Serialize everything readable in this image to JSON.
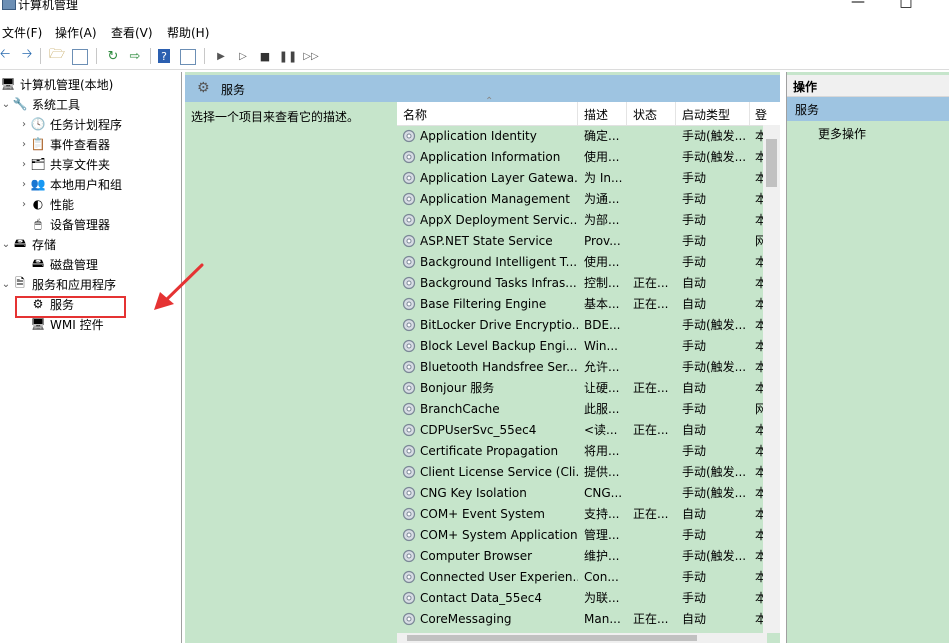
{
  "window": {
    "title": "计算机管理"
  },
  "menu": [
    "文件(F)",
    "操作(A)",
    "查看(V)",
    "帮助(H)"
  ],
  "toolbar": {
    "icons": [
      "back-icon",
      "forward-icon",
      "up-folder-icon",
      "show-hide-tree-icon",
      "refresh-icon",
      "export-list-icon",
      "help-icon",
      "properties-icon",
      "start-service-icon",
      "start-service-alt-icon",
      "stop-service-icon",
      "pause-service-icon",
      "restart-service-icon"
    ]
  },
  "tree": {
    "root": "计算机管理(本地)",
    "system_tools": "系统工具",
    "task_scheduler": "任务计划程序",
    "event_viewer": "事件查看器",
    "shared_folders": "共享文件夹",
    "local_users": "本地用户和组",
    "performance": "性能",
    "device_manager": "设备管理器",
    "storage": "存储",
    "disk_management": "磁盘管理",
    "services_apps": "服务和应用程序",
    "services": "服务",
    "wmi": "WMI 控件"
  },
  "middle": {
    "header": "服务",
    "description": "选择一个项目来查看它的描述。"
  },
  "table": {
    "columns": {
      "name": "名称",
      "desc": "描述",
      "status": "状态",
      "startup": "启动类型",
      "logon": "登"
    },
    "rows": [
      {
        "name": "Application Identity",
        "desc": "确定...",
        "status": "",
        "startup": "手动(触发...",
        "logon": "本"
      },
      {
        "name": "Application Information",
        "desc": "使用...",
        "status": "",
        "startup": "手动(触发...",
        "logon": "本"
      },
      {
        "name": "Application Layer Gatewa...",
        "desc": "为 In...",
        "status": "",
        "startup": "手动",
        "logon": "本"
      },
      {
        "name": "Application Management",
        "desc": "为通...",
        "status": "",
        "startup": "手动",
        "logon": "本"
      },
      {
        "name": "AppX Deployment Servic...",
        "desc": "为部...",
        "status": "",
        "startup": "手动",
        "logon": "本"
      },
      {
        "name": "ASP.NET State Service",
        "desc": "Prov...",
        "status": "",
        "startup": "手动",
        "logon": "网"
      },
      {
        "name": "Background Intelligent T...",
        "desc": "使用...",
        "status": "",
        "startup": "手动",
        "logon": "本"
      },
      {
        "name": "Background Tasks Infras...",
        "desc": "控制...",
        "status": "正在...",
        "startup": "自动",
        "logon": "本"
      },
      {
        "name": "Base Filtering Engine",
        "desc": "基本...",
        "status": "正在...",
        "startup": "自动",
        "logon": "本"
      },
      {
        "name": "BitLocker Drive Encryptio...",
        "desc": "BDE...",
        "status": "",
        "startup": "手动(触发...",
        "logon": "本"
      },
      {
        "name": "Block Level Backup Engi...",
        "desc": "Win...",
        "status": "",
        "startup": "手动",
        "logon": "本"
      },
      {
        "name": "Bluetooth Handsfree Ser...",
        "desc": "允许...",
        "status": "",
        "startup": "手动(触发...",
        "logon": "本"
      },
      {
        "name": "Bonjour 服务",
        "desc": "让硬...",
        "status": "正在...",
        "startup": "自动",
        "logon": "本"
      },
      {
        "name": "BranchCache",
        "desc": "此服...",
        "status": "",
        "startup": "手动",
        "logon": "网"
      },
      {
        "name": "CDPUserSvc_55ec4",
        "desc": "<读...",
        "status": "正在...",
        "startup": "自动",
        "logon": "本"
      },
      {
        "name": "Certificate Propagation",
        "desc": "将用...",
        "status": "",
        "startup": "手动",
        "logon": "本"
      },
      {
        "name": "Client License Service (Cli...",
        "desc": "提供...",
        "status": "",
        "startup": "手动(触发...",
        "logon": "本"
      },
      {
        "name": "CNG Key Isolation",
        "desc": "CNG...",
        "status": "",
        "startup": "手动(触发...",
        "logon": "本"
      },
      {
        "name": "COM+ Event System",
        "desc": "支持...",
        "status": "正在...",
        "startup": "自动",
        "logon": "本"
      },
      {
        "name": "COM+ System Application",
        "desc": "管理...",
        "status": "",
        "startup": "手动",
        "logon": "本"
      },
      {
        "name": "Computer Browser",
        "desc": "维护...",
        "status": "",
        "startup": "手动(触发...",
        "logon": "本"
      },
      {
        "name": "Connected User Experien...",
        "desc": "Con...",
        "status": "",
        "startup": "手动",
        "logon": "本"
      },
      {
        "name": "Contact Data_55ec4",
        "desc": "为联...",
        "status": "",
        "startup": "手动",
        "logon": "本"
      },
      {
        "name": "CoreMessaging",
        "desc": "Man...",
        "status": "正在...",
        "startup": "自动",
        "logon": "本"
      }
    ]
  },
  "actions": {
    "title": "操作",
    "section": "服务",
    "more": "更多操作"
  },
  "colors": {
    "panel_green": "#c6e5cb",
    "header_blue": "#9ec4e1",
    "highlight_red": "#e53333"
  }
}
